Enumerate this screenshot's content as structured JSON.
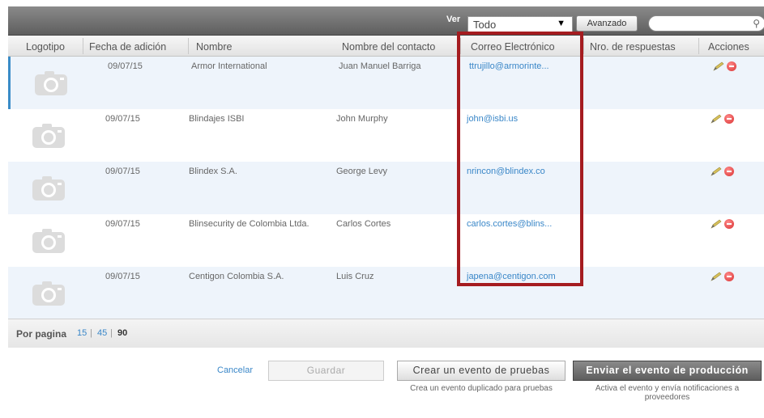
{
  "toolbar": {
    "ver_label": "Ver",
    "filter_value": "Todo",
    "advanced_label": "Avanzado",
    "search_placeholder": ""
  },
  "columns": [
    "Logotipo",
    "Fecha de adición",
    "Nombre",
    "Nombre del contacto",
    "Correo Electrónico",
    "Nro. de respuestas",
    "Acciones"
  ],
  "rows": [
    {
      "date": "09/07/15",
      "name": "Armor International",
      "contact": "Juan Manuel Barriga",
      "email": "ttrujillo@armorinte...",
      "responses": ""
    },
    {
      "date": "09/07/15",
      "name": "Blindajes ISBI",
      "contact": "John Murphy",
      "email": "john@isbi.us",
      "responses": ""
    },
    {
      "date": "09/07/15",
      "name": "Blindex S.A.",
      "contact": "George Levy",
      "email": "nrincon@blindex.co",
      "responses": ""
    },
    {
      "date": "09/07/15",
      "name": "Blinsecurity de Colombia Ltda.",
      "contact": "Carlos Cortes",
      "email": "carlos.cortes@blins...",
      "responses": ""
    },
    {
      "date": "09/07/15",
      "name": "Centigon Colombia S.A.",
      "contact": "Luis Cruz",
      "email": "japena@centigon.com",
      "responses": ""
    }
  ],
  "pagination": {
    "label": "Por pagina",
    "options": [
      "15",
      "45",
      "90"
    ],
    "current": "90",
    "separator": "|"
  },
  "footer": {
    "cancel_label": "Cancelar",
    "save_label": "Guardar",
    "test_label": "Crear un evento de pruebas",
    "test_desc": "Crea un evento duplicado para pruebas",
    "prod_label": "Enviar el evento de producción",
    "prod_desc": "Activa el evento y envía notificaciones a proveedores"
  },
  "colors": {
    "accent_link": "#3a87c8",
    "highlight": "#a51c20",
    "toolbar_bg": "#6e6e6e"
  },
  "icons": {
    "logo_placeholder": "camera-icon",
    "edit": "pencil-icon",
    "delete": "delete-icon",
    "search": "search-icon",
    "dropdown": "caret-down-icon"
  }
}
